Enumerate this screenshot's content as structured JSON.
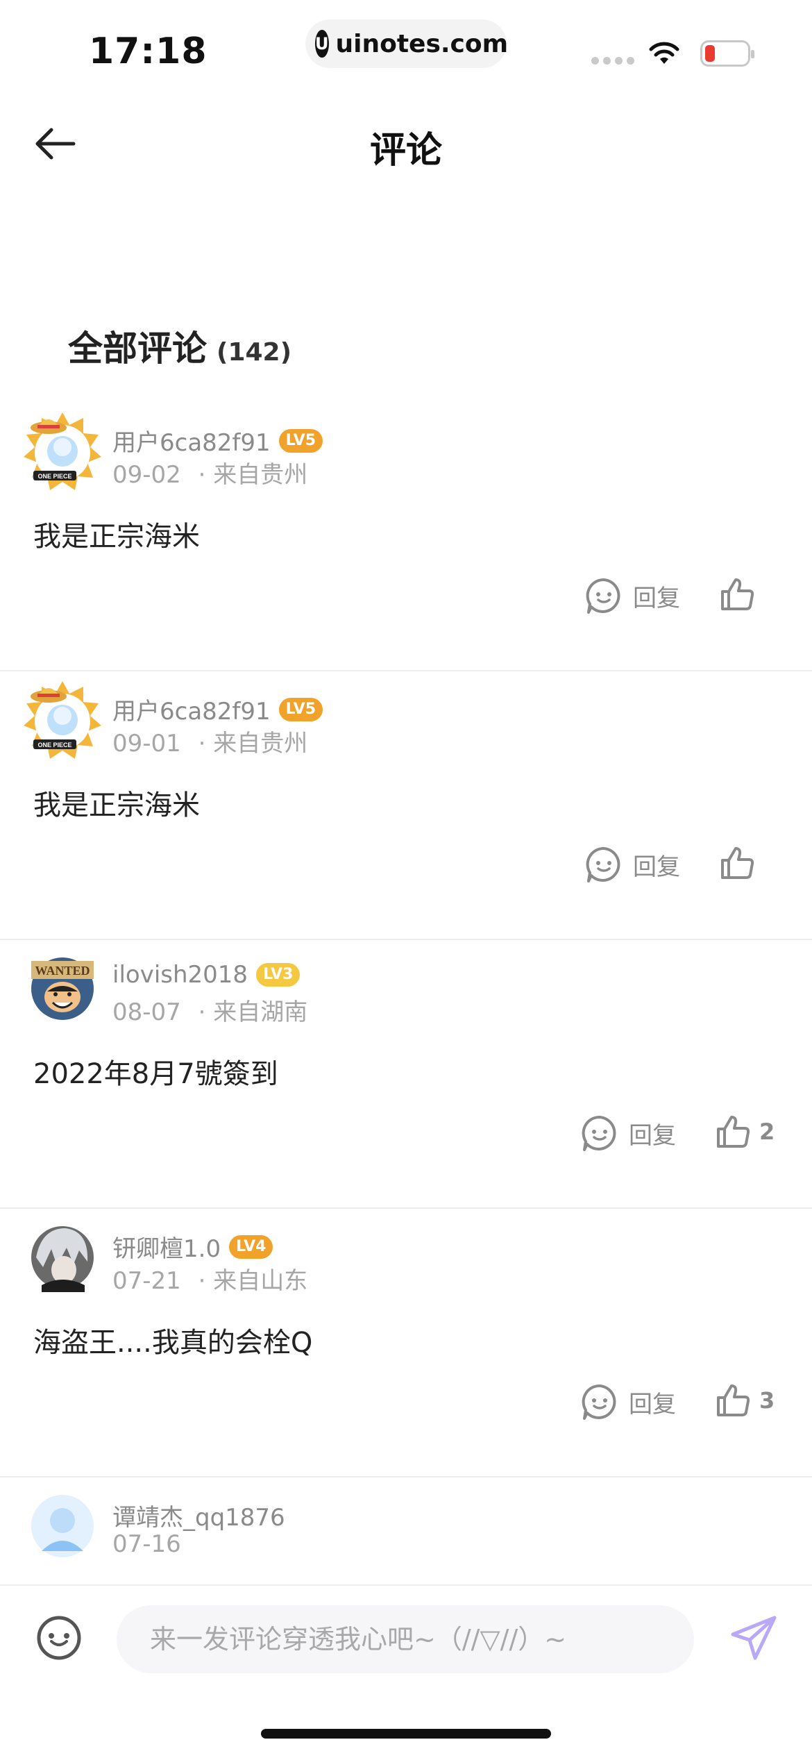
{
  "status_bar": {
    "time": "17:18",
    "url": "uinotes.com",
    "url_logo": "U"
  },
  "nav": {
    "title": "评论"
  },
  "section": {
    "title": "全部评论",
    "count": "(142)"
  },
  "comments": [
    {
      "user": "用户6ca82f91",
      "level": "LV5",
      "level_color": "#f0a22a",
      "date": "09-02",
      "location": "· 来自贵州",
      "content": "我是正宗海米",
      "reply_label": "回复",
      "likes": "",
      "avatar": "onepiece-sun-avatar"
    },
    {
      "user": "用户6ca82f91",
      "level": "LV5",
      "level_color": "#f0a22a",
      "date": "09-01",
      "location": "· 来自贵州",
      "content": "我是正宗海米",
      "reply_label": "回复",
      "likes": "",
      "avatar": "onepiece-sun-avatar"
    },
    {
      "user": "ilovish2018",
      "level": "LV3",
      "level_color": "#f5c842",
      "date": "08-07",
      "location": "· 来自湖南",
      "content": "2022年8月7號簽到",
      "reply_label": "回复",
      "likes": "2",
      "avatar": "luffy-avatar"
    },
    {
      "user": "钘卿檀1.0",
      "level": "LV4",
      "level_color": "#f0a22a",
      "date": "07-21",
      "location": "· 来自山东",
      "content": "海盗王....我真的会栓Q",
      "reply_label": "回复",
      "likes": "3",
      "avatar": "gray-hair-avatar"
    },
    {
      "user": "谭靖杰_qq1876",
      "level": "",
      "level_color": "",
      "date": "07-16",
      "location": "",
      "content": "",
      "reply_label": "",
      "likes": "",
      "avatar": "default-avatar"
    }
  ],
  "input": {
    "placeholder": "来一发评论穿透我心吧~（//▽//）~"
  },
  "colors": {
    "accent_purple": "#b9a8f5",
    "icon_gray": "#8a8a8a"
  }
}
